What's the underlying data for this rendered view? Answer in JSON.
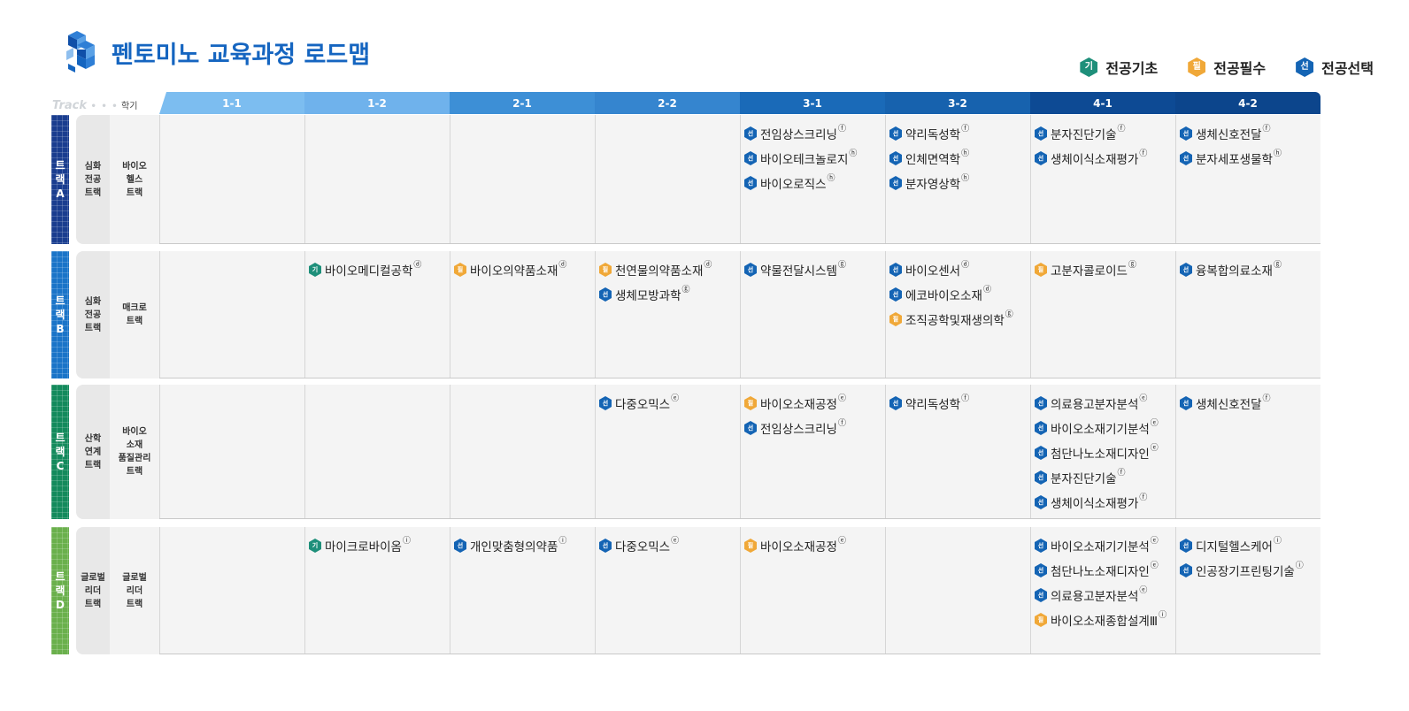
{
  "header": {
    "title": "펜토미노  교육과정  로드맵"
  },
  "legend": [
    {
      "type": "basic",
      "badge": "기",
      "label": "전공기초"
    },
    {
      "type": "req",
      "badge": "필",
      "label": "전공필수"
    },
    {
      "type": "elec",
      "badge": "선",
      "label": "전공선택"
    }
  ],
  "columns_header": {
    "track_label": "Track",
    "semester_label": "학기"
  },
  "semesters": [
    "1-1",
    "1-2",
    "2-1",
    "2-2",
    "3-1",
    "3-2",
    "4-1",
    "4-2"
  ],
  "colors": {
    "title": "#1565c0",
    "basic": "#1e8f7a",
    "required": "#f0a838",
    "elective": "#1464b4",
    "track_a": "#1a3d8f",
    "track_b": "#1a74c8",
    "track_c": "#138a5c",
    "track_d": "#6ab04c"
  },
  "rows": [
    {
      "track": "트랙A",
      "category": "심화 전공 트랙",
      "name": "바이오 헬스 트랙",
      "cells": [
        [],
        [],
        [],
        [],
        [
          {
            "type": "elec",
            "badge": "선",
            "name": "전임상스크리닝",
            "ann": "ⓕ"
          },
          {
            "type": "elec",
            "badge": "선",
            "name": "바이오테크놀로지",
            "ann": "ⓗ"
          },
          {
            "type": "elec",
            "badge": "선",
            "name": "바이오로직스",
            "ann": "ⓗ"
          }
        ],
        [
          {
            "type": "elec",
            "badge": "선",
            "name": "약리독성학",
            "ann": "ⓕ"
          },
          {
            "type": "elec",
            "badge": "선",
            "name": "인체면역학",
            "ann": "ⓗ"
          },
          {
            "type": "elec",
            "badge": "선",
            "name": "분자영상학",
            "ann": "ⓗ"
          }
        ],
        [
          {
            "type": "elec",
            "badge": "선",
            "name": "분자진단기술",
            "ann": "ⓕ"
          },
          {
            "type": "elec",
            "badge": "선",
            "name": "생체이식소재평가",
            "ann": "ⓕ"
          }
        ],
        [
          {
            "type": "elec",
            "badge": "선",
            "name": "생체신호전달",
            "ann": "ⓕ"
          },
          {
            "type": "elec",
            "badge": "선",
            "name": "분자세포생물학",
            "ann": "ⓗ"
          }
        ]
      ]
    },
    {
      "track": "트랙B",
      "category": "심화 전공 트랙",
      "name": "매크로 트랙",
      "cells": [
        [],
        [
          {
            "type": "basic",
            "badge": "기",
            "name": "바이오메디컬공학",
            "ann": "ⓓ"
          }
        ],
        [
          {
            "type": "req",
            "badge": "필",
            "name": "바이오의약품소재",
            "ann": "ⓓ"
          }
        ],
        [
          {
            "type": "req",
            "badge": "필",
            "name": "천연물의약품소재",
            "ann": "ⓓ"
          },
          {
            "type": "elec",
            "badge": "선",
            "name": "생체모방과학",
            "ann": "ⓖ"
          }
        ],
        [
          {
            "type": "elec",
            "badge": "선",
            "name": "약물전달시스템",
            "ann": "ⓖ"
          }
        ],
        [
          {
            "type": "elec",
            "badge": "선",
            "name": "바이오센서",
            "ann": "ⓓ"
          },
          {
            "type": "elec",
            "badge": "선",
            "name": "에코바이오소재",
            "ann": "ⓓ"
          },
          {
            "type": "req",
            "badge": "필",
            "name": "조직공학및재생의학",
            "ann": "ⓖ"
          }
        ],
        [
          {
            "type": "req",
            "badge": "필",
            "name": "고분자콜로이드",
            "ann": "ⓖ"
          }
        ],
        [
          {
            "type": "elec",
            "badge": "선",
            "name": "융복합의료소재",
            "ann": "ⓖ"
          }
        ]
      ]
    },
    {
      "track": "트랙C",
      "category": "산학 연계 트랙",
      "name": "바이오 소재 품질관리 트랙",
      "cells": [
        [],
        [],
        [],
        [
          {
            "type": "elec",
            "badge": "선",
            "name": "다중오믹스",
            "ann": "ⓔ"
          }
        ],
        [
          {
            "type": "req",
            "badge": "필",
            "name": "바이오소재공정",
            "ann": "ⓔ"
          },
          {
            "type": "elec",
            "badge": "선",
            "name": "전임상스크리닝",
            "ann": "ⓕ"
          }
        ],
        [
          {
            "type": "elec",
            "badge": "선",
            "name": "약리독성학",
            "ann": "ⓕ"
          }
        ],
        [
          {
            "type": "elec",
            "badge": "선",
            "name": "의료용고분자분석",
            "ann": "ⓔ"
          },
          {
            "type": "elec",
            "badge": "선",
            "name": "바이오소재기기분석",
            "ann": "ⓔ"
          },
          {
            "type": "elec",
            "badge": "선",
            "name": "첨단나노소재디자인",
            "ann": "ⓔ"
          },
          {
            "type": "elec",
            "badge": "선",
            "name": "분자진단기술",
            "ann": "ⓕ"
          },
          {
            "type": "elec",
            "badge": "선",
            "name": "생체이식소재평가",
            "ann": "ⓕ"
          }
        ],
        [
          {
            "type": "elec",
            "badge": "선",
            "name": "생체신호전달",
            "ann": "ⓕ"
          }
        ]
      ]
    },
    {
      "track": "트랙D",
      "category": "글로벌 리더 트랙",
      "name": "글로벌 리더 트랙",
      "cells": [
        [],
        [
          {
            "type": "basic",
            "badge": "기",
            "name": "마이크로바이옴",
            "ann": "ⓘ"
          }
        ],
        [
          {
            "type": "elec",
            "badge": "선",
            "name": "개인맞춤형의약품",
            "ann": "ⓘ"
          }
        ],
        [
          {
            "type": "elec",
            "badge": "선",
            "name": "다중오믹스",
            "ann": "ⓔ"
          }
        ],
        [
          {
            "type": "req",
            "badge": "필",
            "name": "바이오소재공정",
            "ann": "ⓔ"
          }
        ],
        [],
        [
          {
            "type": "elec",
            "badge": "선",
            "name": "바이오소재기기분석",
            "ann": "ⓔ"
          },
          {
            "type": "elec",
            "badge": "선",
            "name": "첨단나노소재디자인",
            "ann": "ⓔ"
          },
          {
            "type": "elec",
            "badge": "선",
            "name": "의료용고분자분석",
            "ann": "ⓔ"
          },
          {
            "type": "req",
            "badge": "필",
            "name": "바이오소재종합설계Ⅲ",
            "ann": "ⓘ"
          }
        ],
        [
          {
            "type": "elec",
            "badge": "선",
            "name": "디지털헬스케어",
            "ann": "ⓘ"
          },
          {
            "type": "elec",
            "badge": "선",
            "name": "인공장기프린팅기술",
            "ann": "ⓘ"
          }
        ]
      ]
    }
  ]
}
